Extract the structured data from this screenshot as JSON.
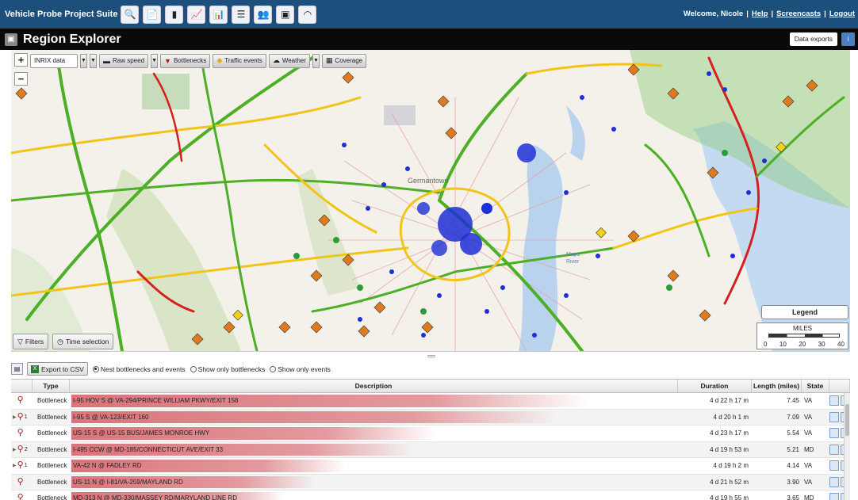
{
  "suite": {
    "title": "Vehicle Probe Project Suite",
    "tools": [
      "map-tool-icon",
      "trend-tool-icon",
      "bar-tool-icon",
      "graph-tool-icon",
      "chart-tool-icon",
      "list-tool-icon",
      "people-tool-icon",
      "report-tool-icon",
      "gauge-tool-icon"
    ],
    "welcome": "Welcome, Nicole",
    "help": "Help",
    "screencasts": "Screencasts",
    "logout": "Logout"
  },
  "region": {
    "title": "Region Explorer",
    "data_exports": "Data exports"
  },
  "map": {
    "data_source": "INRIX data",
    "raw_speed": "Raw speed",
    "bottlenecks": "Bottlenecks",
    "traffic_events": "Traffic events",
    "weather": "Weather",
    "coverage": "Coverage",
    "filters": "Filters",
    "time_selection": "Time selection",
    "legend": "Legend",
    "scale_title": "MILES",
    "scale_ticks": [
      "0",
      "10",
      "20",
      "30",
      "40"
    ],
    "place_labels": [
      "Germantown",
      "Maps River"
    ],
    "colors": {
      "road_good": "#4caf25",
      "road_slow": "#f0c419",
      "road_jam": "#d61f1f",
      "incident": "#1d2fd6",
      "weather": "#7cc36b"
    }
  },
  "table_toolbar": {
    "export_csv": "Export to CSV",
    "opt_nest": "Nest bottlenecks and events",
    "opt_bottlenecks": "Show only bottlenecks",
    "opt_events": "Show only events"
  },
  "table": {
    "headers": {
      "type": "Type",
      "description": "Description",
      "duration": "Duration",
      "length": "Length (miles)",
      "state": "State"
    },
    "rows": [
      {
        "count": "",
        "type": "Bottleneck",
        "description": "I-95 HOV S @ VA-294/PRINCE WILLIAM PKWY/EXIT 158",
        "duration": "4 d 22 h 17 m",
        "length": "7.45",
        "state": "VA",
        "fill": 0.85
      },
      {
        "count": "1",
        "type": "Bottleneck",
        "description": "I-95 S @ VA-123/EXIT 160",
        "duration": "4 d 20 h 1 m",
        "length": "7.09",
        "state": "VA",
        "fill": 0.8
      },
      {
        "count": "",
        "type": "Bottleneck",
        "description": "US-15 S @ US-15 BUS/JAMES MONROE HWY",
        "duration": "4 d 23 h 17 m",
        "length": "5.54",
        "state": "VA",
        "fill": 0.6
      },
      {
        "count": "2",
        "type": "Bottleneck",
        "description": "I-495 CCW @ MD-185/CONNECTICUT AVE/EXIT 33",
        "duration": "4 d 19 h 53 m",
        "length": "5.21",
        "state": "MD",
        "fill": 0.56
      },
      {
        "count": "1",
        "type": "Bottleneck",
        "description": "VA-42 N @ FADLEY RD",
        "duration": "4 d 19 h 2 m",
        "length": "4.14",
        "state": "VA",
        "fill": 0.45
      },
      {
        "count": "",
        "type": "Bottleneck",
        "description": "US-11 N @ I-81/VA-259/MAYLAND RD",
        "duration": "4 d 21 h 52 m",
        "length": "3.90",
        "state": "VA",
        "fill": 0.4
      },
      {
        "count": "",
        "type": "Bottleneck",
        "description": "MD-313 N @ MD-330/MASSEY RD/MARYLAND LINE RD",
        "duration": "4 d 19 h 55 m",
        "length": "3.65",
        "state": "MD",
        "fill": 0.35
      }
    ]
  }
}
